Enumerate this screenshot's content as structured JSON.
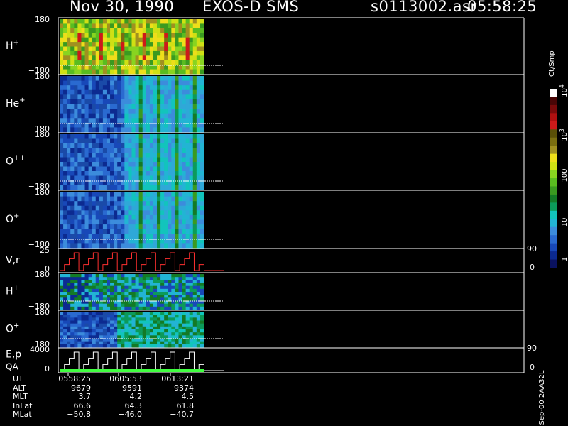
{
  "header": {
    "date": "Nov 30, 1990",
    "mission": "EXOS-D SMS",
    "file": "s0113002.asr",
    "time": "05:58:25"
  },
  "colorbar": {
    "title": "Ct/Smp",
    "tick_labels": [
      "1",
      "10",
      "100",
      "10",
      "10"
    ],
    "tick_exponents": [
      "",
      "",
      "",
      "3",
      "4"
    ],
    "colors": [
      "#0a1260",
      "#0c2a90",
      "#1848b8",
      "#2a6ad0",
      "#3c8cdc",
      "#22b4d4",
      "#12c4bc",
      "#0c9a5a",
      "#137a26",
      "#3a9a20",
      "#5abc20",
      "#88d420",
      "#d0e014",
      "#eede1a",
      "#a09020",
      "#7a6e10",
      "#5a5008",
      "#cc1a1a",
      "#b01010",
      "#7a0a0a",
      "#4a0606",
      "#ffffff"
    ],
    "side_label": "Sep-00 2AA32L"
  },
  "chart_data": {
    "type": "heatmap",
    "title": "Nov 30, 1990   EXOS-D SMS",
    "time_ticks": [
      "0558:25",
      "0605:53",
      "0613:21"
    ],
    "panels": [
      {
        "name": "H",
        "superscript": "+",
        "ytop": "180",
        "ybot": "−180",
        "palette": "h"
      },
      {
        "name": "He",
        "superscript": "+",
        "ytop": "180",
        "ybot": "−180",
        "palette": "blue"
      },
      {
        "name": "O",
        "superscript": "++",
        "ytop": "180",
        "ybot": "−180",
        "palette": "blue"
      },
      {
        "name": "O",
        "superscript": "+",
        "ytop": "180",
        "ybot": "−180",
        "palette": "blue"
      },
      {
        "name": "V,r",
        "superscript": "",
        "ytop": "25",
        "ybot": "0",
        "right_top": "90",
        "right_bot": "0",
        "palette": "line"
      },
      {
        "name": "H",
        "superscript": "+",
        "ytop": "180",
        "ybot": "−180",
        "palette": "mixed"
      },
      {
        "name": "O",
        "superscript": "+",
        "ytop": "180",
        "ybot": "−180",
        "palette": "mixed2"
      },
      {
        "name": "E,p",
        "superscript": "",
        "name2": "QA",
        "ytop": "4000",
        "ybot": "0",
        "right_top": "90",
        "right_bot": "0",
        "palette": "step"
      }
    ],
    "ephemeris": [
      {
        "label": "UT",
        "values": [
          "0558:25",
          "0605:53",
          "0613:21"
        ]
      },
      {
        "label": "ALT",
        "values": [
          "9679",
          "9591",
          "9374"
        ]
      },
      {
        "label": "MLT",
        "values": [
          "3.7",
          "4.2",
          "4.5"
        ]
      },
      {
        "label": "InLat",
        "values": [
          "66.6",
          "64.3",
          "61.8"
        ]
      },
      {
        "label": "MLat",
        "values": [
          "−50.8",
          "−46.0",
          "−40.7"
        ]
      }
    ]
  }
}
